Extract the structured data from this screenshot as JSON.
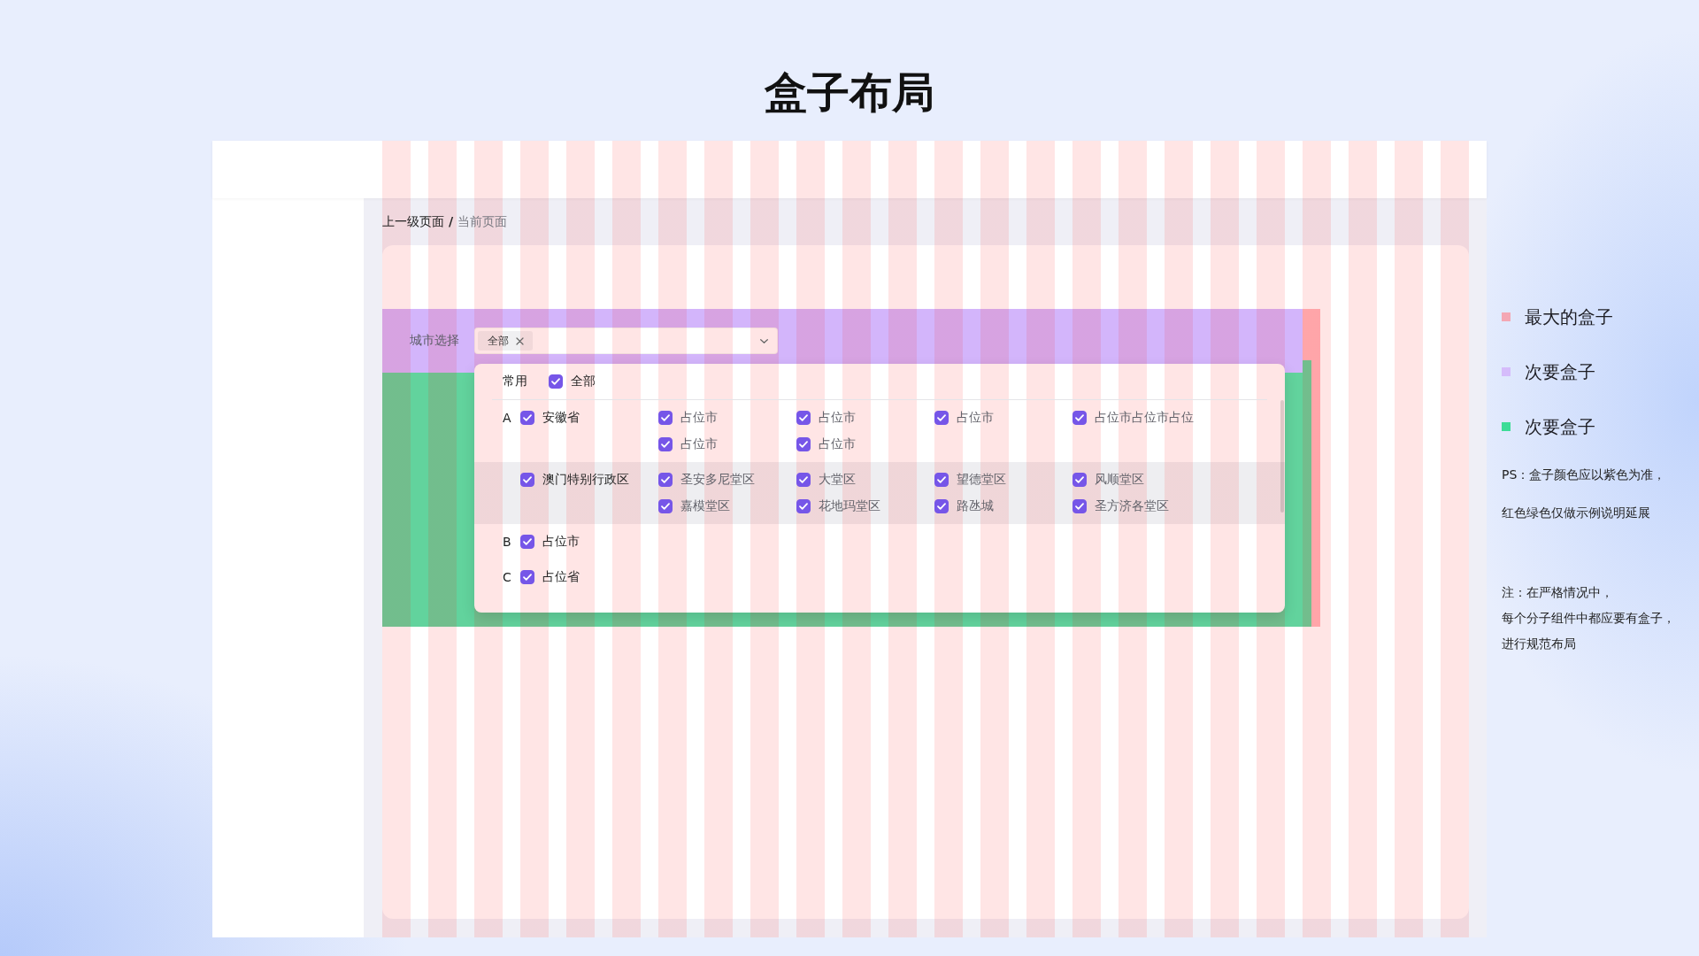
{
  "title": "盒子布局",
  "breadcrumb": {
    "items": [
      {
        "label": "上一级页面",
        "selected": false
      },
      {
        "label": "当前页面",
        "selected": true
      }
    ],
    "separator": "/"
  },
  "city_filter": {
    "label": "城市选择",
    "tags": [
      {
        "label": "全部"
      }
    ],
    "dropdown": {
      "common": {
        "label": "常用",
        "options": [
          {
            "label": "全部",
            "checked": true
          }
        ]
      },
      "groups": [
        {
          "letter": "A",
          "provinces": [
            {
              "label": "安徽省",
              "checked": true,
              "hovered": false,
              "cities": [
                {
                  "label": "占位市",
                  "checked": true
                },
                {
                  "label": "占位市",
                  "checked": true
                },
                {
                  "label": "占位市",
                  "checked": true
                },
                {
                  "label": "占位市占位市占位",
                  "checked": true
                },
                {
                  "label": "占位市",
                  "checked": true
                },
                {
                  "label": "占位市",
                  "checked": true
                }
              ]
            },
            {
              "label": "澳门特别行政区",
              "checked": true,
              "hovered": true,
              "cities": [
                {
                  "label": "圣安多尼堂区",
                  "checked": true
                },
                {
                  "label": "大堂区",
                  "checked": true
                },
                {
                  "label": "望德堂区",
                  "checked": true
                },
                {
                  "label": "风顺堂区",
                  "checked": true
                },
                {
                  "label": "嘉模堂区",
                  "checked": true
                },
                {
                  "label": "花地玛堂区",
                  "checked": true
                },
                {
                  "label": "路氹城",
                  "checked": true
                },
                {
                  "label": "圣方济各堂区",
                  "checked": true
                }
              ]
            }
          ]
        },
        {
          "letter": "B",
          "provinces": [
            {
              "label": "占位市",
              "checked": true,
              "hovered": false
            }
          ]
        },
        {
          "letter": "C",
          "provinces": [
            {
              "label": "占位省",
              "checked": true,
              "hovered": false
            }
          ]
        }
      ]
    }
  },
  "legend": {
    "items": [
      {
        "label": "最大的盒子",
        "color": "#f4a7b4"
      },
      {
        "label": "次要盒子",
        "color": "#d5bcfb"
      },
      {
        "label": "次要盒子",
        "color": "#3ddc97"
      }
    ],
    "notes": [
      {
        "lines": [
          "PS：盒子颜色应以紫色为准，",
          "红色绿色仅做示例说明延展"
        ]
      },
      {
        "lines": [
          "注：在严格情况中，",
          "每个分子组件中都应要有盒子，",
          "进行规范布局"
        ]
      }
    ]
  }
}
